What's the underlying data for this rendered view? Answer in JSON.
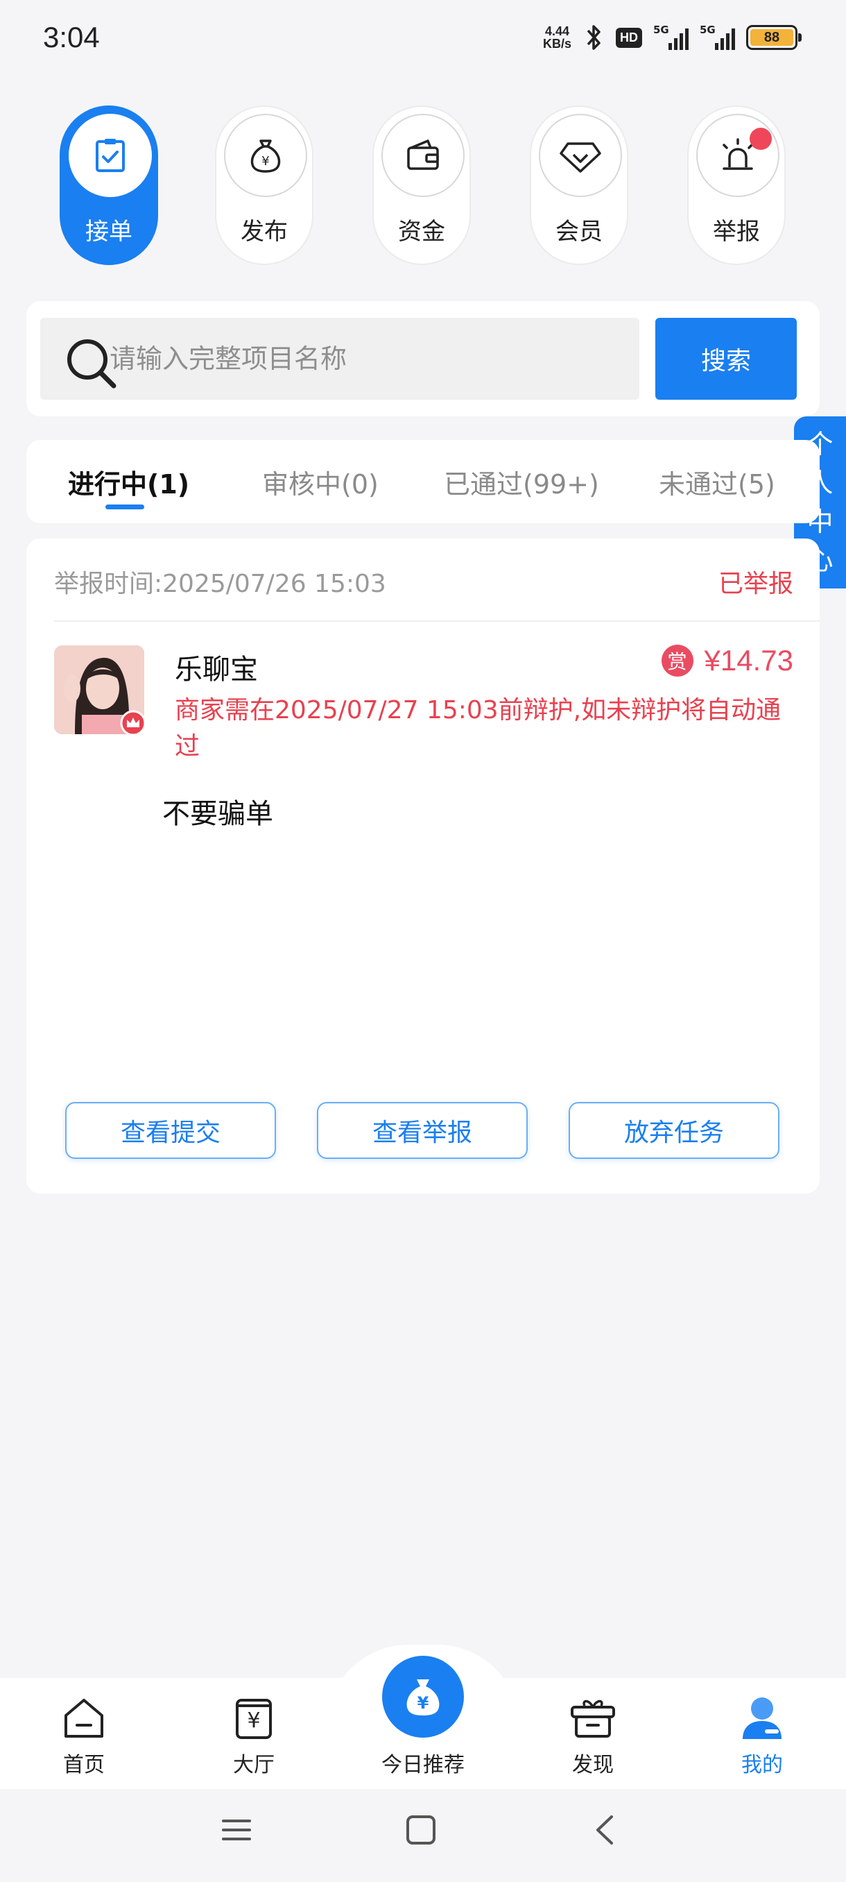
{
  "status_bar": {
    "time": "3:04",
    "net_speed_value": "4.44",
    "net_speed_unit": "KB/s",
    "hd_label": "HD",
    "signal1": "5G",
    "signal2": "5G",
    "battery": "88"
  },
  "actions": [
    {
      "label": "接单",
      "icon": "clipboard-check-icon",
      "active": true
    },
    {
      "label": "发布",
      "icon": "money-bag-icon",
      "active": false
    },
    {
      "label": "资金",
      "icon": "wallet-icon",
      "active": false
    },
    {
      "label": "会员",
      "icon": "diamond-icon",
      "active": false
    },
    {
      "label": "举报",
      "icon": "alarm-light-icon",
      "active": false,
      "has_notification": true
    }
  ],
  "search": {
    "placeholder": "请输入完整项目名称",
    "button_label": "搜索"
  },
  "side_tab": {
    "chars": [
      "个",
      "人",
      "中",
      "心"
    ]
  },
  "tabs": [
    {
      "label": "进行中(1)",
      "active": true
    },
    {
      "label": "审核中(0)",
      "active": false
    },
    {
      "label": "已通过(99+)",
      "active": false
    },
    {
      "label": "未通过(5)",
      "active": false
    }
  ],
  "task": {
    "report_time": "举报时间:2025/07/26 15:03",
    "status": "已举报",
    "merchant": "乐聊宝",
    "reward_badge": "赏",
    "reward_amount": "¥14.73",
    "deadline_notice": "商家需在2025/07/27 15:03前辩护,如未辩护将自动通过",
    "reason": "不要骗单",
    "buttons": {
      "view_submission": "查看提交",
      "view_report": "查看举报",
      "abandon": "放弃任务"
    }
  },
  "bottom_nav": {
    "home": "首页",
    "hall": "大厅",
    "today": "今日推荐",
    "discover": "发现",
    "mine": "我的"
  },
  "colors": {
    "accent": "#1a7ff0",
    "danger": "#e8414f",
    "reward": "#e94c62"
  }
}
